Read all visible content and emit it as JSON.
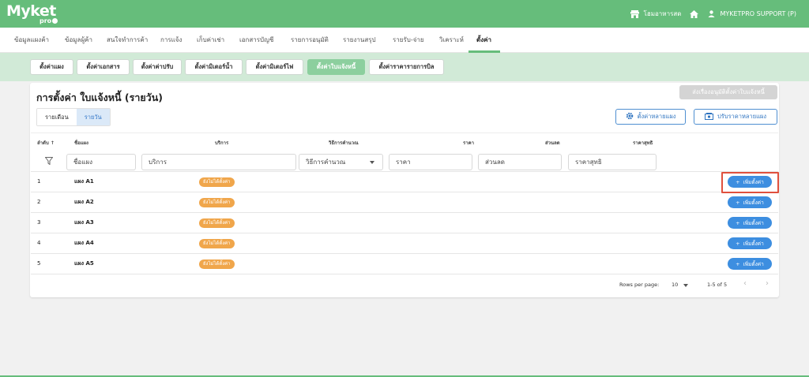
{
  "app": {
    "logo_main": "Myket",
    "logo_sub": "pro",
    "store_name": "โฮมอาหารสด",
    "user_name": "MYKETPRO SUPPORT (P)"
  },
  "menu": [
    {
      "label": "ข้อมูลแผงค้า"
    },
    {
      "label": "ข้อมูลผู้ค้า"
    },
    {
      "label": "สนใจทำการค้า"
    },
    {
      "label": "การแจ้ง"
    },
    {
      "label": "เก็บค่าเช่า"
    },
    {
      "label": "เอกสารบัญชี"
    },
    {
      "label": "รายการอนุมัติ"
    },
    {
      "label": "รายงานสรุป"
    },
    {
      "label": "รายรับ-จ่าย"
    },
    {
      "label": "วิเคราะห์"
    },
    {
      "label": "ตั้งค่า",
      "active": true
    }
  ],
  "subtabs": [
    {
      "label": "ตั้งค่าแผง"
    },
    {
      "label": "ตั้งค่าเอกสาร"
    },
    {
      "label": "ตั้งค่าค่าปรับ"
    },
    {
      "label": "ตั้งค่ามิเตอร์น้ำ"
    },
    {
      "label": "ตั้งค่ามิเตอร์ไฟ"
    },
    {
      "label": "ตั้งค่าใบแจ้งหนี้",
      "active": true
    },
    {
      "label": "ตั้งค่าราคารายการบิล"
    }
  ],
  "page": {
    "title": "การตั้งค่า ใบแจ้งหนี้ (รายวัน)",
    "approve_button": "ส่งเรื่องอนุมัติตั้งค่าใบแจ้งหนี้",
    "toggle": {
      "monthly": "รายเดือน",
      "daily": "รายวัน"
    },
    "bulk_setting_button": "ตั้งค่าหลายแผง",
    "bulk_price_button": "ปรับราคาหลายแผง"
  },
  "table": {
    "headers": {
      "order": "ลำดับ ↑",
      "stall": "ชื่อแผง",
      "service": "บริการ",
      "calc": "วิธีการคำนวณ",
      "price": "ราคา",
      "discount": "ส่วนลด",
      "net": "ราคาสุทธิ"
    },
    "filters": {
      "stall": "ชื่อแผง",
      "service": "บริการ",
      "calc": "วิธีการคำนวณ",
      "price": "ราคา",
      "discount": "ส่วนลด",
      "net": "ราคาสุทธิ"
    },
    "rows": [
      {
        "order": "1",
        "stall": "แผง A1",
        "status": "ยังไม่ได้ตั้งค่า",
        "action": "เพิ่มตั้งค่า"
      },
      {
        "order": "2",
        "stall": "แผง A2",
        "status": "ยังไม่ได้ตั้งค่า",
        "action": "เพิ่มตั้งค่า"
      },
      {
        "order": "3",
        "stall": "แผง A3",
        "status": "ยังไม่ได้ตั้งค่า",
        "action": "เพิ่มตั้งค่า"
      },
      {
        "order": "4",
        "stall": "แผง A4",
        "status": "ยังไม่ได้ตั้งค่า",
        "action": "เพิ่มตั้งค่า"
      },
      {
        "order": "5",
        "stall": "แผง A5",
        "status": "ยังไม่ได้ตั้งค่า",
        "action": "เพิ่มตั้งค่า"
      }
    ]
  },
  "pagination": {
    "rows_per_page_label": "Rows per page:",
    "rows_per_page_value": "10",
    "range": "1-5 of 5"
  },
  "colors": {
    "brand_green": "#66bd7b",
    "accent_blue": "#3d8ee0",
    "status_orange": "#f0a64b",
    "highlight_red": "#e0503d"
  }
}
